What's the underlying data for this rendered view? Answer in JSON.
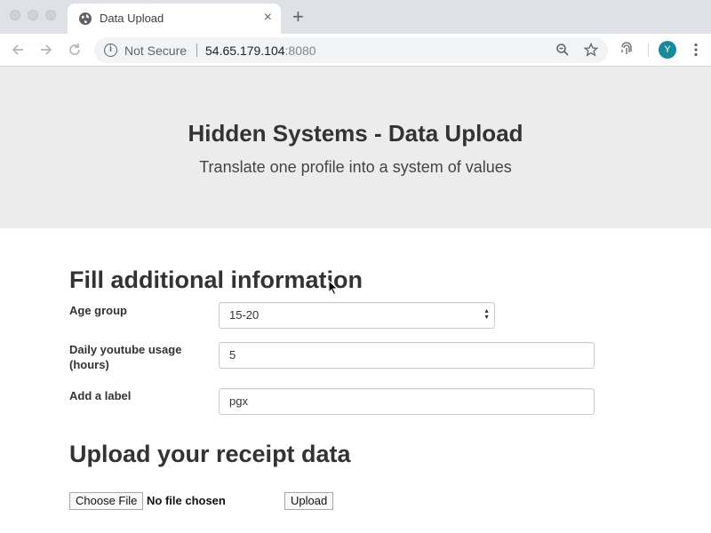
{
  "browser": {
    "tab_title": "Data Upload",
    "tab_close": "×",
    "new_tab": "+",
    "security_label": "Not Secure",
    "url_host": "54.65.179.104",
    "url_port": ":8080",
    "avatar_letter": "Y",
    "icons": [
      "back-arrow-icon",
      "forward-arrow-icon",
      "reload-icon",
      "info-icon",
      "zoom-icon",
      "star-icon",
      "fingerprint-icon",
      "menu-dots-icon"
    ]
  },
  "header": {
    "title": "Hidden Systems - Data Upload",
    "subtitle": "Translate one profile into a system of values"
  },
  "form": {
    "section_title": "Fill additional information",
    "age_group_label": "Age group",
    "age_group_value": "15-20",
    "youtube_label": "Daily youtube usage (hours)",
    "youtube_value": "5",
    "label_label": "Add a label",
    "label_value": "pgx"
  },
  "upload": {
    "section_title": "Upload your receipt data",
    "choose_file_label": "Choose File",
    "file_status": "No file chosen",
    "upload_label": "Upload"
  },
  "colors": {
    "jumbotron_bg": "#ececec",
    "tab_strip_bg": "#dee1e6",
    "avatar_bg": "#1a8a9a"
  }
}
